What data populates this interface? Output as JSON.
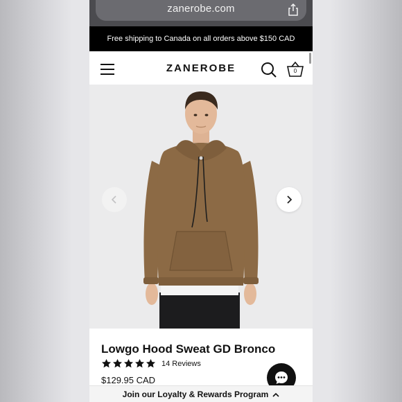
{
  "browser": {
    "url": "zanerobe.com"
  },
  "promo": {
    "text": "Free shipping to Canada on all orders above $150 CAD"
  },
  "header": {
    "logo": "ZANEROBE",
    "cart_count": "0"
  },
  "product": {
    "title": "Lowgo Hood Sweat GD Bronco",
    "rating": 5,
    "reviews": "14 Reviews",
    "price": "$129.95 CAD",
    "hoodie_color": "#8c6a45"
  },
  "loyalty": {
    "text": "Join our Loyalty & Rewards Program"
  },
  "icons": [
    "share-icon",
    "menu-icon",
    "search-icon",
    "basket-icon",
    "chevron-left-icon",
    "chevron-right-icon",
    "star-icon",
    "chat-icon",
    "chevron-up-icon"
  ]
}
